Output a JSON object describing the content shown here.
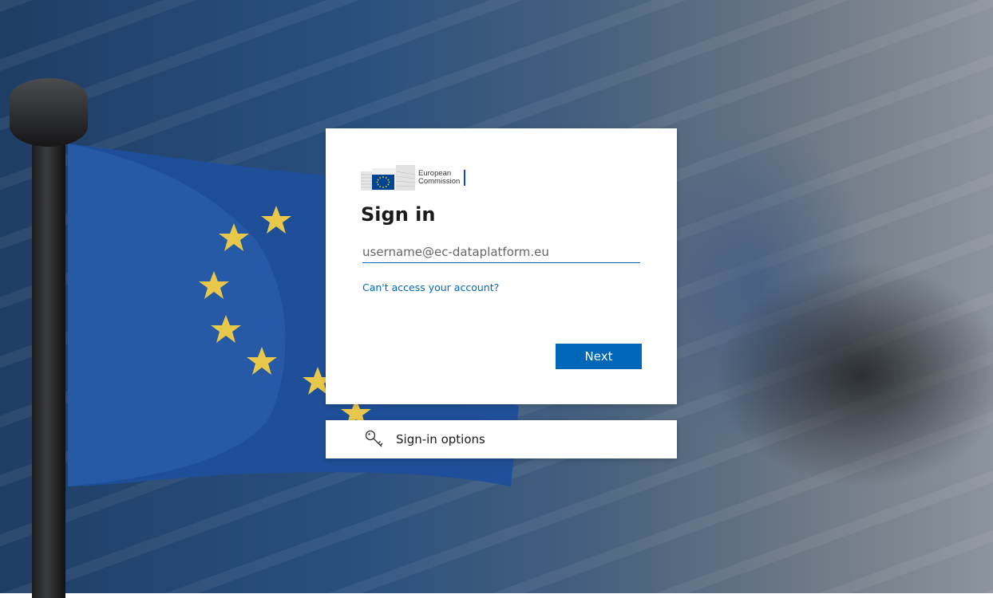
{
  "page": {
    "logo_line1": "European",
    "logo_line2": "Commission",
    "title": "Sign in",
    "username_placeholder": "username@ec-dataplatform.eu",
    "username_value": "",
    "cant_access_link": "Can't access your account?",
    "next_label": "Next",
    "signin_options_label": "Sign-in options"
  },
  "colors": {
    "accent": "#0067b8",
    "eu_blue": "#004494",
    "eu_gold": "#ffd617"
  },
  "icons": {
    "logo": "european-commission-logo",
    "signin_options": "key-search-icon"
  }
}
